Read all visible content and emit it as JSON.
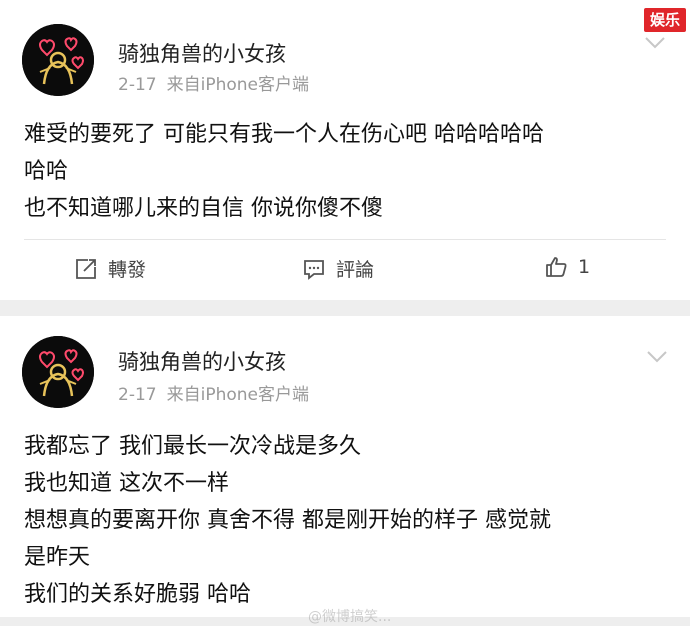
{
  "watermark": {
    "badge": "娱乐",
    "bottom_text": "@微博搞笑..."
  },
  "posts": [
    {
      "username": "骑独角兽的小女孩",
      "date": "2-17",
      "source": "来自iPhone客户端",
      "lines": [
        "难受的要死了 可能只有我一个人在伤心吧 哈哈哈哈哈",
        "哈哈",
        "也不知道哪儿来的自信 你说你傻不傻"
      ],
      "actions": {
        "repost": "轉發",
        "comment": "評論",
        "like_count": "1"
      }
    },
    {
      "username": "骑独角兽的小女孩",
      "date": "2-17",
      "source": "来自iPhone客户端",
      "lines": [
        "我都忘了 我们最长一次冷战是多久",
        "我也知道 这次不一样",
        "想想真的要离开你 真舍不得 都是刚开始的样子 感觉就",
        "是昨天",
        "我们的关系好脆弱  哈哈"
      ]
    }
  ],
  "colors": {
    "accent_badge": "#e0262a",
    "meta_gray": "#999999",
    "background": "#eeeeee"
  },
  "icons": [
    "avatar-image",
    "chevron-down-icon",
    "repost-icon",
    "comment-icon",
    "like-icon"
  ]
}
